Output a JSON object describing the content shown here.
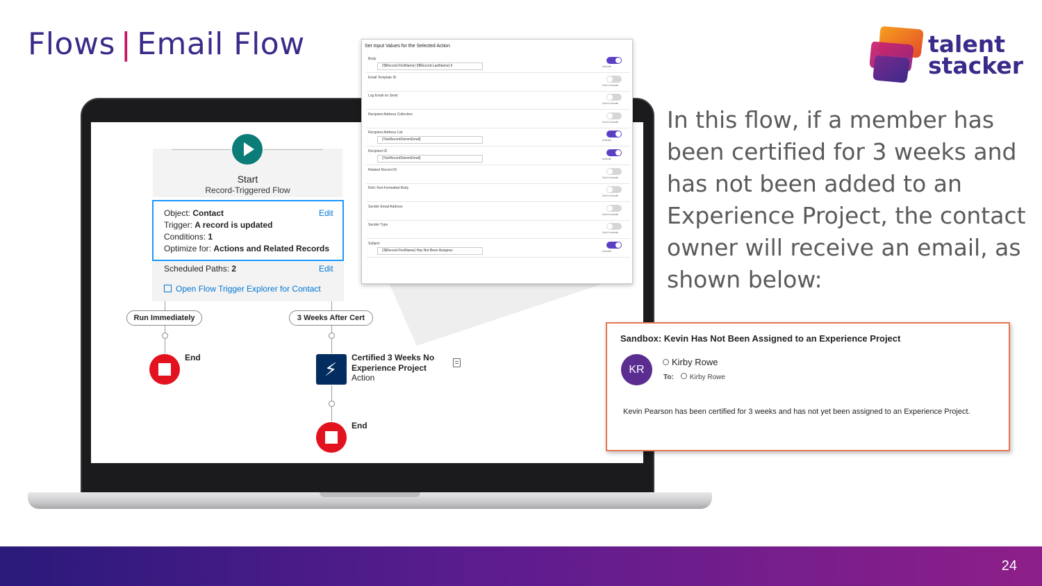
{
  "slide": {
    "title_left": "Flows",
    "title_sep": "|",
    "title_right": "Email Flow",
    "description": "In this flow, if a member has been certified for 3 weeks and has not been added to an Experience Project, the contact owner will receive an email, as shown below:",
    "page_number": "24"
  },
  "logo": {
    "line1": "talent",
    "line2": "stacker"
  },
  "flow": {
    "start_title": "Start",
    "start_subtitle": "Record-Triggered Flow",
    "object_label": "Object:",
    "object_value": "Contact",
    "trigger_label": "Trigger:",
    "trigger_value": "A record is updated",
    "conditions_label": "Conditions:",
    "conditions_value": "1",
    "optimize_label": "Optimize for:",
    "optimize_value": "Actions and Related Records",
    "edit_label": "Edit",
    "scheduled_label": "Scheduled Paths:",
    "scheduled_value": "2",
    "open_explorer": "Open Flow Trigger Explorer for Contact",
    "path_immediate": "Run Immediately",
    "path_scheduled": "3 Weeks After Cert",
    "end_label": "End",
    "action_title": "Certified 3 Weeks No Experience Project",
    "action_type": "Action"
  },
  "input_panel": {
    "title": "Set Input Values for the Selected Action",
    "rows": [
      {
        "label": "Body",
        "value": "{!$Record.FirstName} {!$Record.LastName} h",
        "toggle": "on",
        "toggle_label": "Include"
      },
      {
        "label": "Email Template ID",
        "value": "",
        "toggle": "off",
        "toggle_label": "Don't Include"
      },
      {
        "label": "Log Email on Send",
        "value": "",
        "toggle": "off",
        "toggle_label": "Don't Include"
      },
      {
        "label": "Recipient Address Collection",
        "value": "",
        "toggle": "off",
        "toggle_label": "Don't Include"
      },
      {
        "label": "Recipient Address List",
        "value": "{!VarRecordOwnerEmail}",
        "toggle": "on",
        "toggle_label": "Include"
      },
      {
        "label": "Recipient ID",
        "value": "{!VarRecordOwnerEmail}",
        "toggle": "on",
        "toggle_label": "Include"
      },
      {
        "label": "Related Record ID",
        "value": "",
        "toggle": "off",
        "toggle_label": "Don't Include"
      },
      {
        "label": "Rich-Text-Formatted Body",
        "value": "",
        "toggle": "off",
        "toggle_label": "Don't Include"
      },
      {
        "label": "Sender Email Address",
        "value": "",
        "toggle": "off",
        "toggle_label": "Don't Include"
      },
      {
        "label": "Sender Type",
        "value": "",
        "toggle": "off",
        "toggle_label": "Don't Include"
      },
      {
        "label": "Subject",
        "value": "{!$Record.FirstName} Has Not Been Assignec",
        "toggle": "on",
        "toggle_label": "Include"
      }
    ]
  },
  "email": {
    "subject": "Sandbox: Kevin Has Not Been Assigned to an Experience Project",
    "avatar_initials": "KR",
    "sender": "Kirby Rowe",
    "to_label": "To:",
    "to_value": "Kirby Rowe",
    "body": "Kevin Pearson has been certified for 3 weeks and has not yet been assigned to an Experience Project."
  },
  "colors": {
    "title_purple": "#3b2a8a",
    "title_separator": "#c0135f",
    "flow_start_teal": "#0b7c77",
    "end_red": "#e3121f",
    "action_navy": "#032d60",
    "toggle_on": "#5b3fc4",
    "email_border": "#e67650",
    "footer_gradient_start": "#2a1a7a",
    "footer_gradient_end": "#8e1f8a"
  }
}
